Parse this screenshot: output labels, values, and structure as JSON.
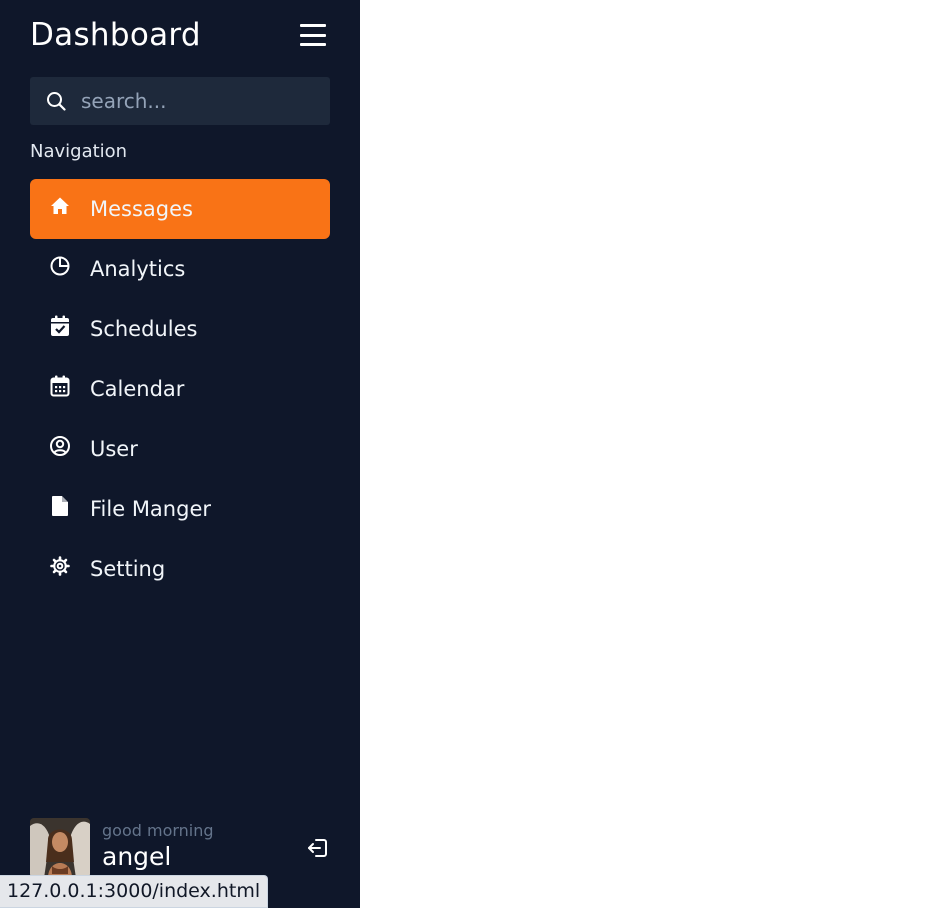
{
  "header": {
    "title": "Dashboard"
  },
  "search": {
    "placeholder": "search...",
    "value": ""
  },
  "navigation": {
    "label": "Navigation",
    "items": [
      {
        "label": "Messages",
        "icon": "home-icon",
        "active": true
      },
      {
        "label": "Analytics",
        "icon": "pie-chart-icon",
        "active": false
      },
      {
        "label": "Schedules",
        "icon": "calendar-check-icon",
        "active": false
      },
      {
        "label": "Calendar",
        "icon": "calendar-icon",
        "active": false
      },
      {
        "label": "User",
        "icon": "user-circle-icon",
        "active": false
      },
      {
        "label": "File Manger",
        "icon": "file-icon",
        "active": false
      },
      {
        "label": "Setting",
        "icon": "gear-icon",
        "active": false
      }
    ]
  },
  "profile": {
    "greeting": "good morning",
    "name": "angel"
  },
  "status_bar": {
    "url": "127.0.0.1:3000/index.html"
  },
  "colors": {
    "sidebar_bg": "#0f172a",
    "search_bg": "#1e293b",
    "accent": "#f97316",
    "muted_text": "#64748b",
    "placeholder": "#94a3b8"
  }
}
